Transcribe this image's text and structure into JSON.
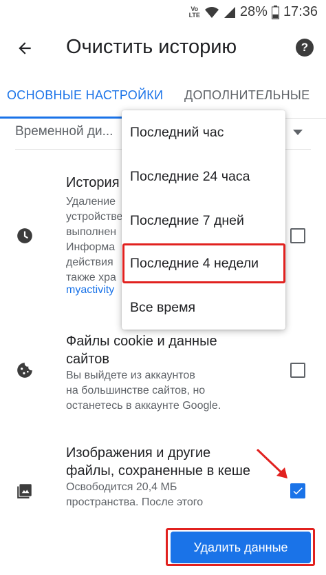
{
  "status_bar": {
    "network_label": "VoLTE",
    "battery": "28%",
    "time": "17:36"
  },
  "app_bar": {
    "title": "Очистить историю",
    "back_icon": "arrow-back-icon",
    "help_icon": "help-icon"
  },
  "tabs": [
    {
      "label": "ОСНОВНЫЕ НАСТРОЙКИ",
      "active": true
    },
    {
      "label": "ДОПОЛНИТЕЛЬНЫЕ",
      "active": false
    }
  ],
  "time_range": {
    "label": "Временной ди..."
  },
  "items": [
    {
      "icon": "clock-icon",
      "title": "История",
      "description_lines": [
        "Удаление",
        "устройстве",
        "выполнен",
        "Информа",
        "действия",
        "также хра"
      ],
      "link": "myactivity",
      "checked": false
    },
    {
      "icon": "cookie-icon",
      "title_lines": [
        "Файлы cookie и данные",
        "сайтов"
      ],
      "description_lines": [
        "Вы выйдете из аккаунтов",
        "на большинстве сайтов, но",
        "останетесь в аккаунте Google."
      ],
      "checked": false
    },
    {
      "icon": "image-icon",
      "title_lines": [
        "Изображения и другие",
        "файлы, сохраненные в кеше"
      ],
      "description_lines": [
        "Освободится 20,4 МБ",
        "пространства. После этого"
      ],
      "checked": true
    }
  ],
  "dropdown": {
    "options": [
      "Последний час",
      "Последние 24 часа",
      "Последние 7 дней",
      "Последние 4 недели",
      "Все время"
    ],
    "highlighted_index": 3
  },
  "delete_button": {
    "label": "Удалить данные"
  },
  "colors": {
    "accent": "#1a73e8",
    "highlight_red": "#e1211f"
  }
}
